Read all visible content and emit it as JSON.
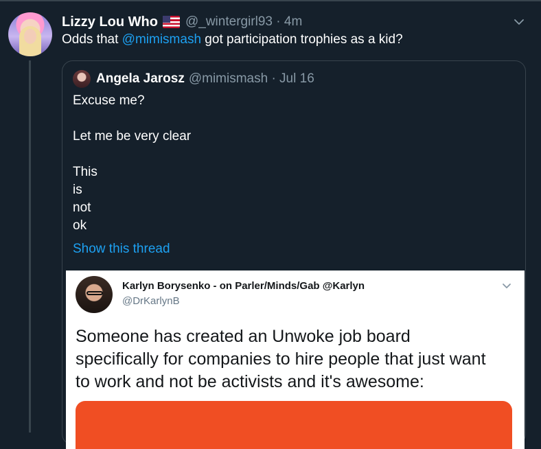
{
  "tweet": {
    "author_name": "Lizzy Lou Who",
    "author_handle": "@_wintergirl93 · 4m",
    "text_before": "Odds that ",
    "mention": "@mimismash",
    "text_after": " got participation trophies as a kid?"
  },
  "quoted_tweet": {
    "author_name": "Angela Jarosz",
    "author_handle": "@mimismash · Jul 16",
    "lines": [
      "Excuse me?",
      "Let me be very clear",
      "This",
      "is",
      "not",
      "ok"
    ],
    "show_thread": "Show this thread"
  },
  "embedded_tweet": {
    "author_name": "Karlyn Borysenko - on Parler/Minds/Gab @Karlyn",
    "author_handle": "@DrKarlynB",
    "lines": [
      "Someone has created an Unwoke job board",
      "specifically for companies to hire people that just want",
      "to work and not be activists and it's awesome:"
    ]
  },
  "icons": {
    "flag": "us-flag-icon",
    "menu": "chevron-down-icon"
  },
  "colors": {
    "background": "#15202b",
    "accent": "#1da1f2",
    "muted": "#8899a6",
    "embed_image": "#f04e23"
  }
}
